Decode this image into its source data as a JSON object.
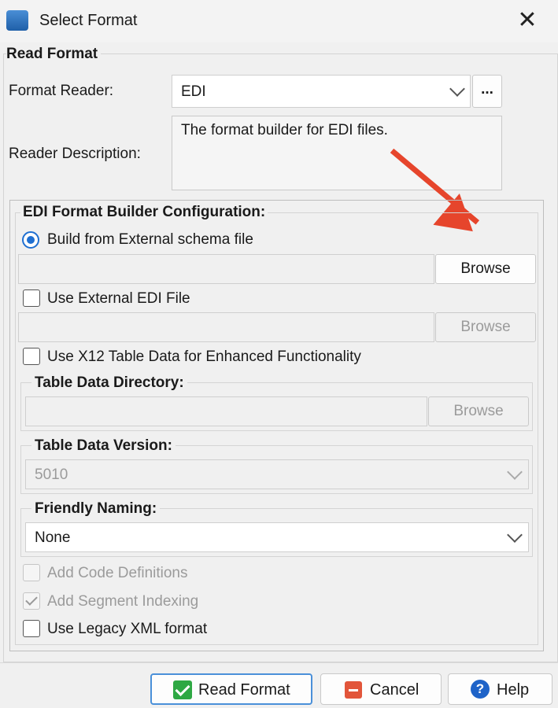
{
  "window": {
    "title": "Select Format",
    "close_glyph": "✕"
  },
  "read_format": {
    "group_title": "Read Format",
    "format_reader_label": "Format Reader:",
    "format_reader_value": "EDI",
    "more_button": "...",
    "reader_description_label": "Reader Description:",
    "reader_description": "The format builder for EDI files."
  },
  "config": {
    "title": "EDI Format Builder Configuration:",
    "build_external_schema": {
      "label": "Build from External schema file",
      "selected": true,
      "browse": "Browse"
    },
    "use_external_edi": {
      "label": "Use External EDI File",
      "checked": false,
      "browse": "Browse"
    },
    "use_x12": {
      "label": "Use X12 Table Data for Enhanced Functionality",
      "checked": false
    },
    "table_data_directory": {
      "title": "Table Data Directory:",
      "browse": "Browse"
    },
    "table_data_version": {
      "title": "Table Data Version:",
      "value": "5010"
    },
    "friendly_naming": {
      "title": "Friendly Naming:",
      "value": "None"
    },
    "add_code_definitions": {
      "label": "Add Code Definitions",
      "checked": false,
      "enabled": false
    },
    "add_segment_indexing": {
      "label": "Add Segment Indexing",
      "checked": true,
      "enabled": false
    },
    "use_legacy_xml": {
      "label": "Use Legacy XML format",
      "checked": false
    }
  },
  "footer": {
    "read_format": "Read Format",
    "cancel": "Cancel",
    "help": "Help"
  },
  "icons": {
    "app": "app-icon",
    "ok": "check-icon",
    "cancel": "minus-icon",
    "help": "help-icon"
  },
  "colors": {
    "accent": "#1f6fd1",
    "annotation_arrow": "#e6452c",
    "ok": "#2ea843",
    "cancel": "#e2553a",
    "help": "#1e63c8"
  }
}
